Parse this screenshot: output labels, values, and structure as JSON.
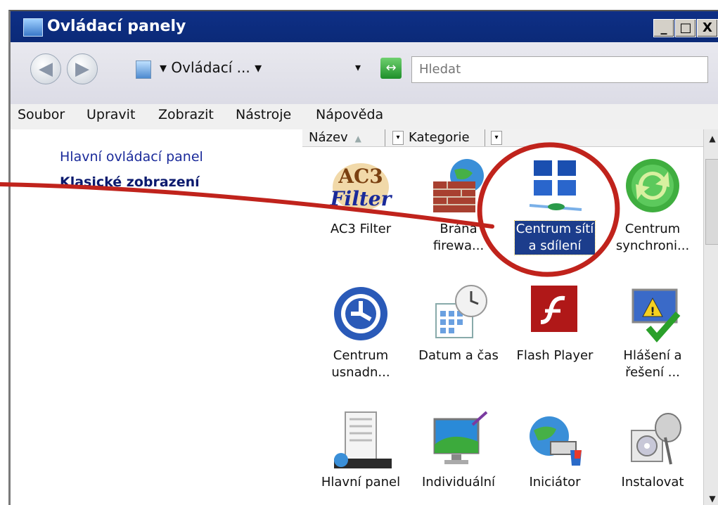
{
  "window": {
    "title": "Ovládací panely",
    "min": "_",
    "max": "□",
    "close": "X"
  },
  "nav": {
    "back": "◀",
    "forward": "▶",
    "breadcrumb": "▾ Ovládací ... ▾",
    "dropdown": "▾",
    "refresh": "↔",
    "search_placeholder": "Hledat"
  },
  "menu": {
    "items": [
      "Soubor",
      "Upravit",
      "Zobrazit",
      "Nástroje",
      "Nápověda"
    ]
  },
  "left": {
    "links": [
      "Hlavní ovládací panel",
      "Klasické zobrazení"
    ]
  },
  "columns": {
    "name": "Název",
    "sort": "▲",
    "category": "Kategorie"
  },
  "items": [
    {
      "label": "AC3 Filter",
      "icon": "ac3-filter-icon"
    },
    {
      "label": "Brána\nfirewa...",
      "icon": "firewall-icon"
    },
    {
      "label": "Centrum sítí\na sdílení",
      "icon": "network-center-icon",
      "selected": true
    },
    {
      "label": "Centrum\nsynchroni...",
      "icon": "sync-center-icon"
    },
    {
      "label": "Centrum\nusnadn...",
      "icon": "ease-of-access-icon"
    },
    {
      "label": "Datum a čas",
      "icon": "date-time-icon"
    },
    {
      "label": "Flash Player",
      "icon": "flash-player-icon"
    },
    {
      "label": "Hlášení a\nřešení ...",
      "icon": "problem-reports-icon"
    },
    {
      "label": "Hlavní panel",
      "icon": "taskbar-icon"
    },
    {
      "label": "Individuální",
      "icon": "personalization-icon"
    },
    {
      "label": "Iniciátor",
      "icon": "iscsi-initiator-icon"
    },
    {
      "label": "Instalovat",
      "icon": "install-icon"
    }
  ],
  "colors": {
    "title_bar": "#0e2f86",
    "selection": "#1c3d8c",
    "annotation": "#c0231c"
  }
}
